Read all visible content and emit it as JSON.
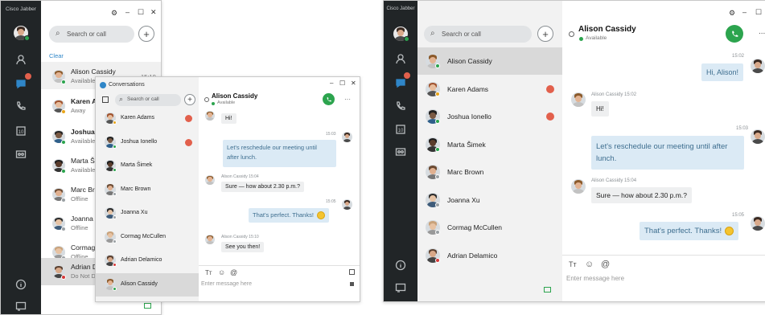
{
  "app": {
    "brand": "Cisco Jabber"
  },
  "left_main": {
    "search_placeholder": "Search or call",
    "clear_label": "Clear",
    "contacts": [
      {
        "name": "Alison Cassidy",
        "status": "Available",
        "time": "15:10"
      },
      {
        "name": "Karen Ac",
        "status": "Away"
      },
      {
        "name": "Joshua Io",
        "status": "Available"
      },
      {
        "name": "Marta Ši",
        "status": "Available"
      },
      {
        "name": "Marc Bro",
        "status": "Offline"
      },
      {
        "name": "Joanna X",
        "status": "Offline"
      },
      {
        "name": "Cormag",
        "status": "Offline"
      },
      {
        "name": "Adrian D",
        "status": "Do Not D"
      }
    ]
  },
  "conv_window": {
    "title": "Conversations",
    "search_placeholder": "Search or call",
    "contacts": [
      "Karen Adams",
      "Joshua Ionello",
      "Marta Šimek",
      "Marc Brown",
      "Joanna Xu",
      "Cormag McCullen",
      "Adrian Delamico",
      "Alison Cassidy"
    ],
    "chat": {
      "name": "Alison Cassidy",
      "status": "Available",
      "messages": [
        {
          "dir": "in",
          "text": "Hi!"
        },
        {
          "dir": "out",
          "time": "15:03",
          "line1": "Let's reschedule our meeting until",
          "line2": "after lunch."
        },
        {
          "dir": "in",
          "meta": "Alison Cassidy 15:04",
          "text": "Sure — how about 2.30 p.m.?"
        },
        {
          "dir": "out",
          "time": "15:05",
          "text": "That's perfect. Thanks!"
        },
        {
          "dir": "in",
          "meta": "Alison Cassidy 15:10",
          "text": "See you then!"
        }
      ],
      "compose_placeholder": "Enter message here",
      "format_label": "Tт",
      "emoji_label": "☺",
      "mention_label": "@"
    }
  },
  "right_window": {
    "brand": "Cisco Jabber",
    "search_placeholder": "Search or call",
    "contacts": [
      {
        "name": "Alison Cassidy"
      },
      {
        "name": "Karen Adams"
      },
      {
        "name": "Joshua Ionello"
      },
      {
        "name": "Marta Šimek"
      },
      {
        "name": "Marc Brown"
      },
      {
        "name": "Joanna Xu"
      },
      {
        "name": "Cormag McCullen"
      },
      {
        "name": "Adrian Delamico"
      }
    ],
    "chat": {
      "name": "Alison Cassidy",
      "status": "Available",
      "more": "...",
      "messages": [
        {
          "dir": "out",
          "time": "15:02",
          "text": "Hi, Alison!"
        },
        {
          "dir": "in",
          "meta": "Alison Cassidy 15:02",
          "text": "Hi!"
        },
        {
          "dir": "out",
          "time": "15:03",
          "line1": "Let's reschedule our meeting until after",
          "line2": "lunch."
        },
        {
          "dir": "in",
          "meta": "Alison Cassidy 15:04",
          "text": "Sure — how about 2.30 p.m.?"
        },
        {
          "dir": "out",
          "time": "15:05",
          "text": "That's perfect. Thanks!"
        }
      ],
      "compose_placeholder": "Enter message here",
      "format_label": "Tт",
      "emoji_label": "☺",
      "mention_label": "@"
    }
  },
  "window_controls": {
    "settings": "⚙",
    "minimize": "–",
    "maximize": "☐",
    "close": "✕"
  },
  "colors": {
    "rail": "#212527",
    "available": "#2ca44e",
    "away": "#e8a51a",
    "busy": "#d63a3a",
    "badge": "#e2604c",
    "link": "#2f86c8"
  }
}
